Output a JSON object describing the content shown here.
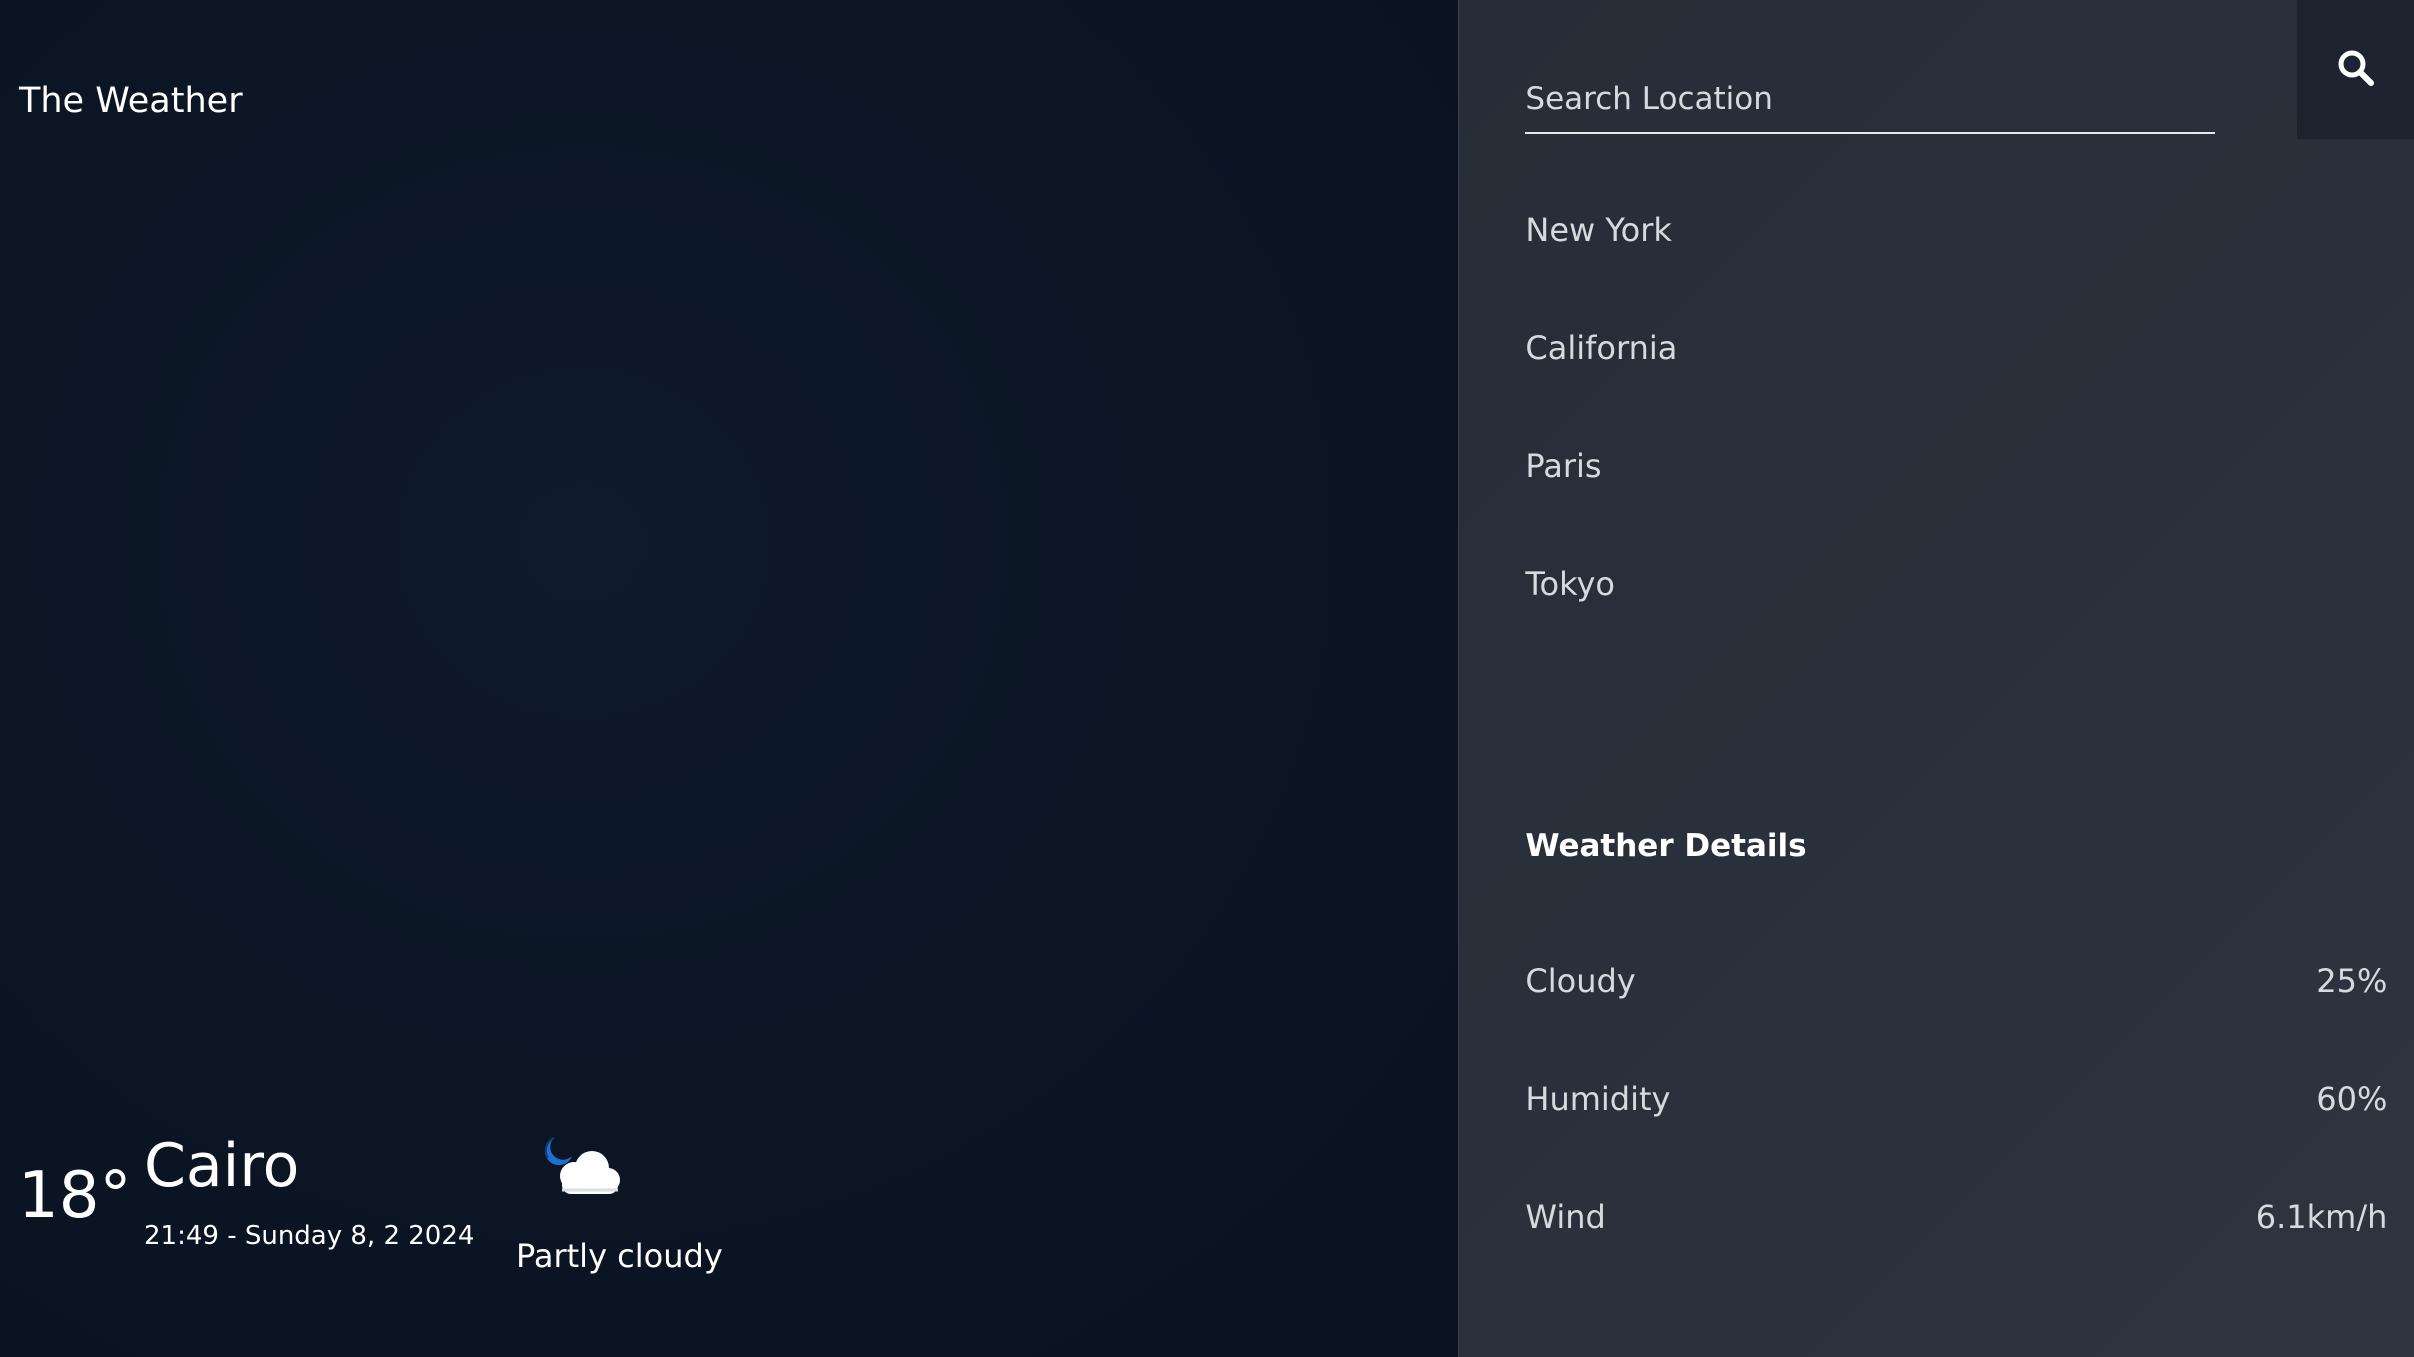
{
  "app": {
    "brand": "The Weather"
  },
  "current": {
    "temperature": "18°",
    "city": "Cairo",
    "datetime": "21:49 - Sunday 8, 2 2024",
    "condition": "Partly cloudy",
    "condition_icon": "moon-cloud-icon"
  },
  "search": {
    "placeholder": "Search Location",
    "value": "",
    "button_icon": "search-icon"
  },
  "locations": [
    "New York",
    "California",
    "Paris",
    "Tokyo"
  ],
  "details": {
    "title": "Weather Details",
    "rows": [
      {
        "label": "Cloudy",
        "value": "25%"
      },
      {
        "label": "Humidity",
        "value": "60%"
      },
      {
        "label": "Wind",
        "value": "6.1km/h"
      }
    ]
  },
  "colors": {
    "main_background": "#0b1524",
    "sidebar_background": "#2a303b",
    "search_button_background": "#1d2430",
    "text_primary": "#ffffff",
    "text_secondary": "#d6d9de"
  }
}
